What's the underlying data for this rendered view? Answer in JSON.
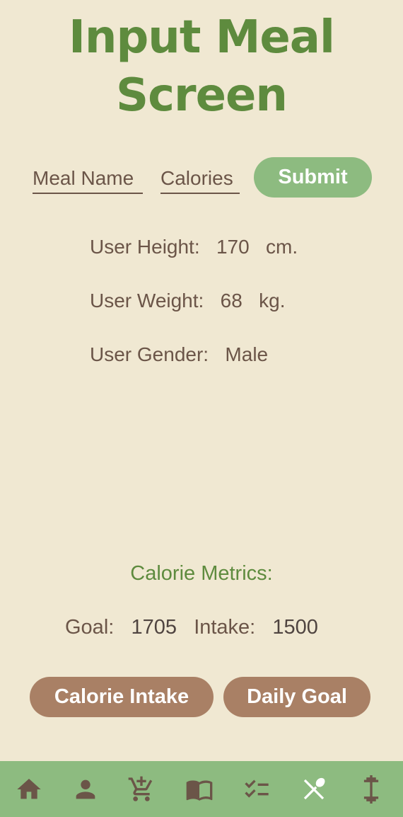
{
  "title": {
    "line1": "Input Meal",
    "line2": "Screen"
  },
  "form": {
    "meal_placeholder": "Meal Name",
    "calories_placeholder": "Calories",
    "submit_label": "Submit"
  },
  "user": {
    "height_label": "User Height:",
    "height_value": "170",
    "height_unit": "cm.",
    "weight_label": "User Weight:",
    "weight_value": "68",
    "weight_unit": "kg.",
    "gender_label": "User Gender:",
    "gender_value": "Male"
  },
  "metrics": {
    "title": "Calorie Metrics:",
    "goal_label": "Goal:",
    "goal_value": "1705",
    "intake_label": "Intake:",
    "intake_value": "1500"
  },
  "buttons": {
    "calorie_intake": "Calorie Intake",
    "daily_goal": "Daily Goal"
  },
  "nav": {
    "items": [
      "home-icon",
      "person-icon",
      "cart-add-icon",
      "book-icon",
      "checklist-icon",
      "fork-spoon-icon",
      "dumbbell-icon"
    ],
    "active": "fork-spoon-icon"
  },
  "colors": {
    "background": "#f0e8d2",
    "title": "#5e8b3e",
    "accent_green": "#8dbb80",
    "accent_brown": "#a98065",
    "text": "#6b5548"
  }
}
